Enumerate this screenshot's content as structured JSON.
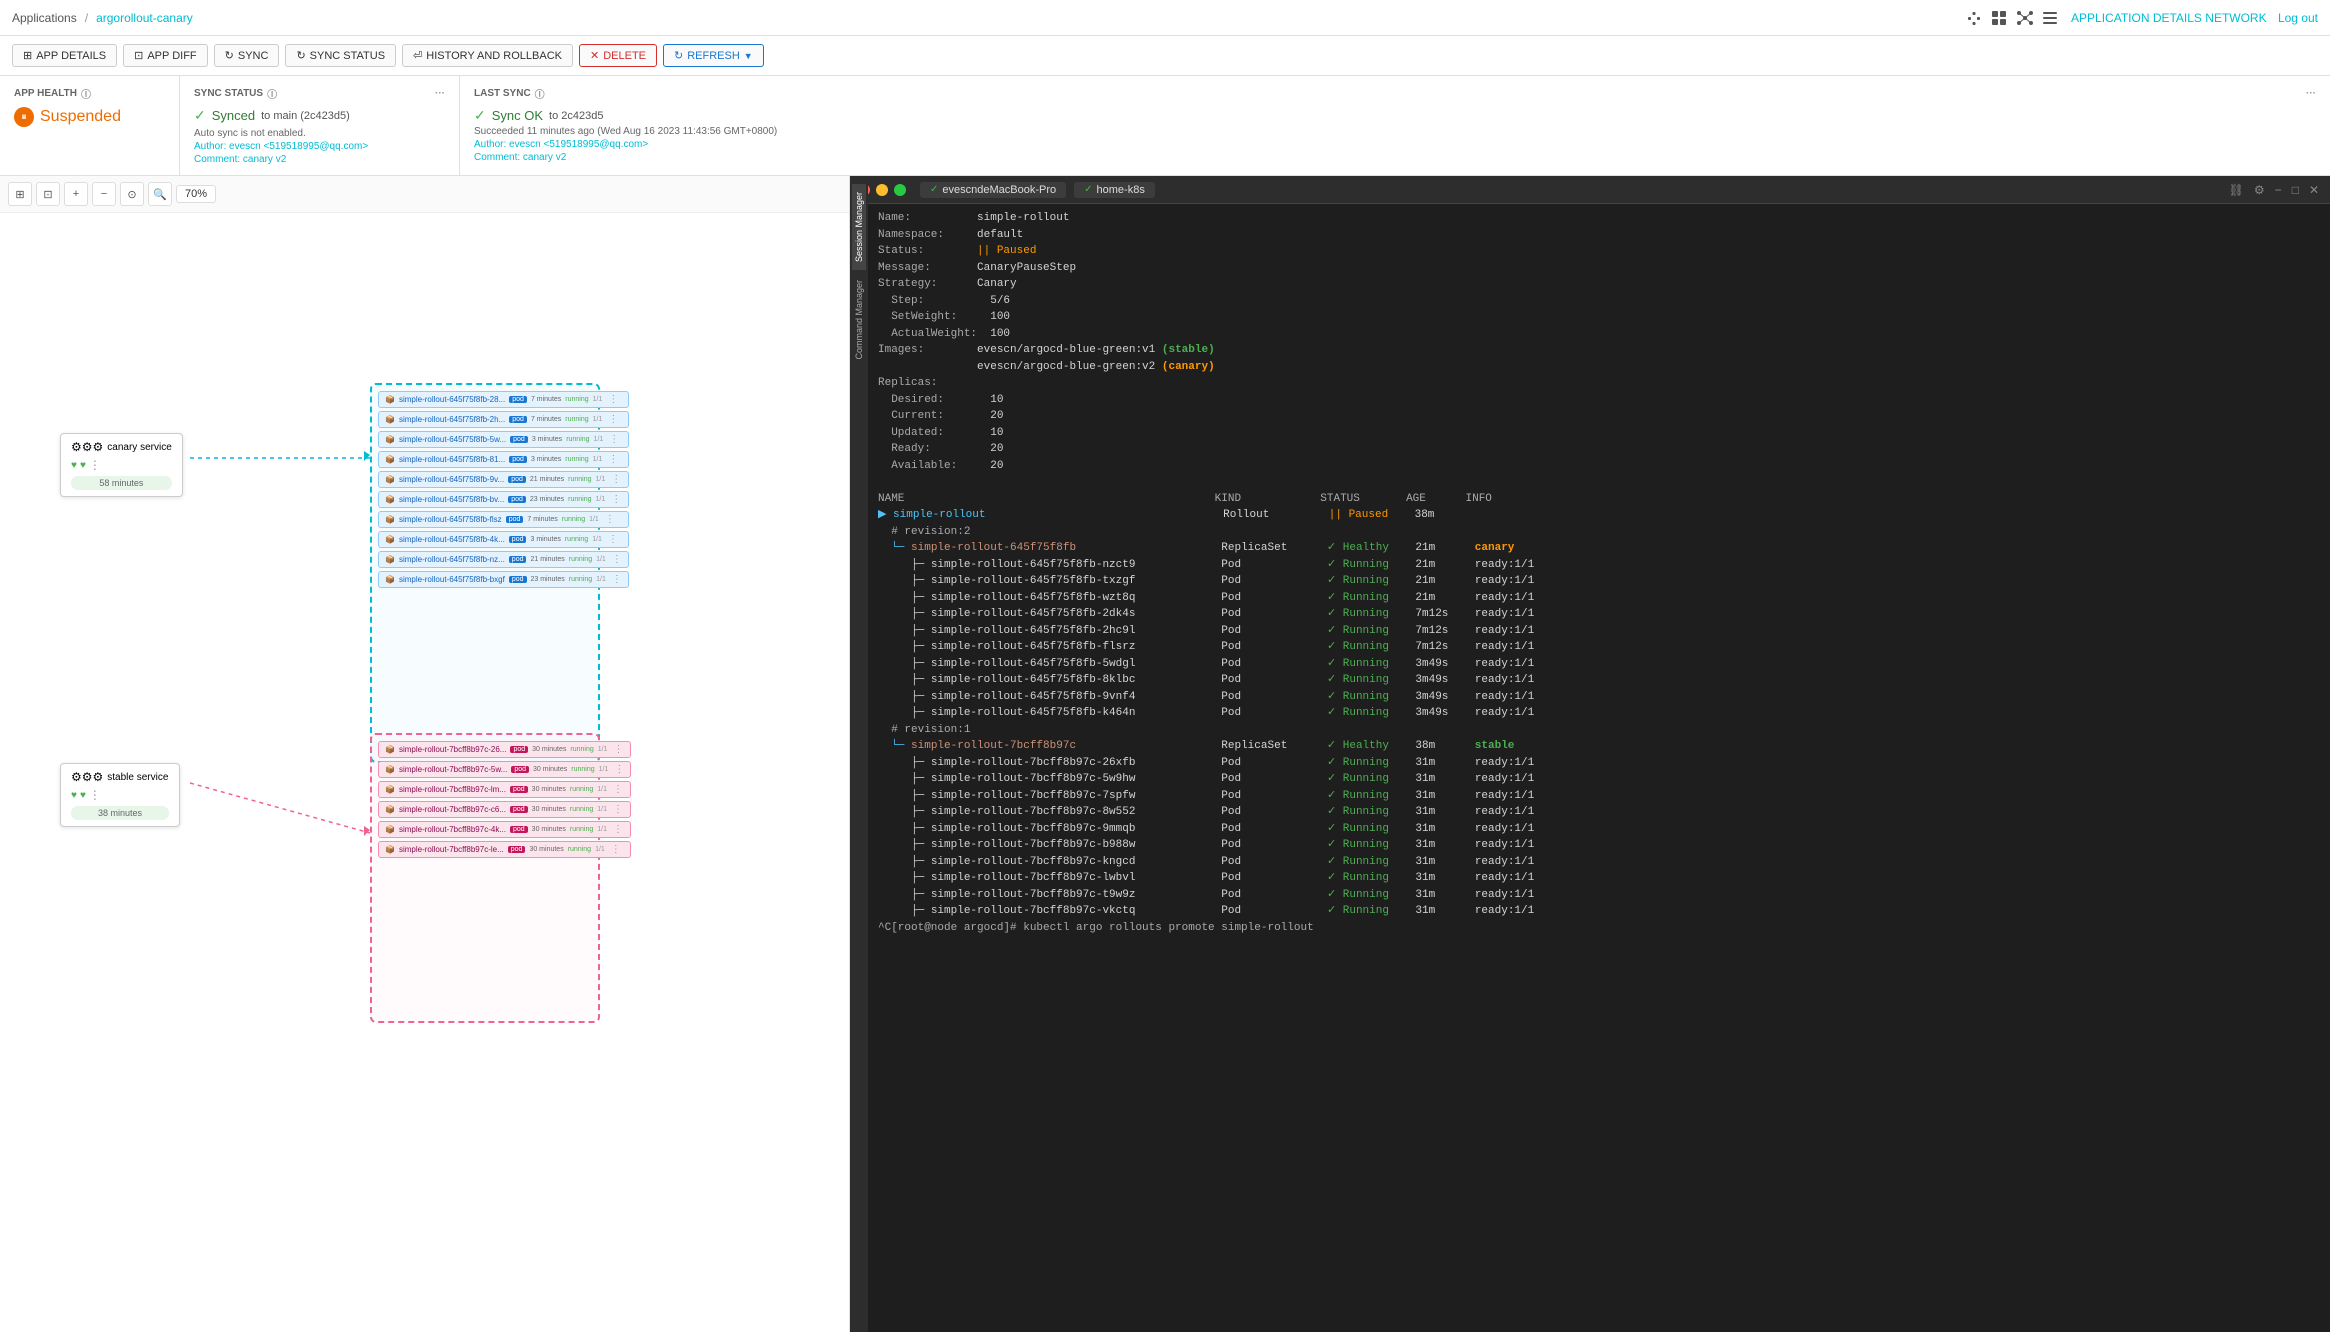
{
  "nav": {
    "applications_label": "Applications",
    "app_name": "argorollout-canary",
    "right_nav": "APPLICATION DETAILS  NETWORK",
    "logout": "Log out"
  },
  "toolbar": {
    "app_details": "APP DETAILS",
    "app_diff": "APP DIFF",
    "sync": "SYNC",
    "sync_status": "SYNC STATUS",
    "history_rollback": "HISTORY AND ROLLBACK",
    "delete": "DELETE",
    "refresh": "REFRESH"
  },
  "status": {
    "app_health_label": "APP HEALTH",
    "health_value": "Suspended",
    "sync_status_label": "SYNC STATUS",
    "synced_text": "Synced",
    "synced_to": "to main (2c423d5)",
    "auto_sync_note": "Auto sync is not enabled.",
    "author_label": "Author:",
    "author_value": "evescn <519518995@qq.com>",
    "comment_label": "Comment:",
    "comment_value": "canary v2",
    "last_sync_label": "LAST SYNC",
    "sync_ok_text": "Sync OK",
    "sync_ok_to": "to 2c423d5",
    "sync_ok_detail": "Succeeded 11 minutes ago (Wed Aug 16 2023 11:43:56 GMT+0800)",
    "sync_ok_author": "evescn <519518995@qq.com>",
    "sync_ok_comment": "canary v2"
  },
  "graph": {
    "zoom": "70%",
    "canary_service_label": "canary service",
    "stable_service_label": "stable service",
    "canary_time": "58 minutes",
    "stable_time": "38 minutes",
    "pods_canary": [
      "simple-rollout-645f75f8fb-28...",
      "simple-rollout-645f75f8fb-2h...",
      "simple-rollout-645f75f8fb-5w...",
      "simple-rollout-645f75f8fb-81...",
      "simple-rollout-645f75f8fb-9v...",
      "simple-rollout-645f75f8fb-bv...",
      "simple-rollout-645f75f8fb-flsz",
      "simple-rollout-645f75f8fb-4k...",
      "simple-rollout-645f75f8fb-nz...",
      "simple-rollout-645f75f8fb-bxgf"
    ],
    "pods_stable": [
      "simple-rollout-7bcff8b97c-26...",
      "simple-rollout-7bcff8b97c-5w...",
      "simple-rollout-7bcff8b97c-lm...",
      "simple-rollout-7bcff8b97c-c6...",
      "simple-rollout-7bcff8b97c-4k...",
      "simple-rollout-7bcff8b97c-le..."
    ]
  },
  "terminal": {
    "tab1": "evescndeMacBook-Pro",
    "tab2": "home-k8s",
    "side_tab1": "Session Manager",
    "side_tab2": "Command Manager",
    "content": {
      "name": "simple-rollout",
      "namespace": "default",
      "status": "|| Paused",
      "message": "CanaryPauseStep",
      "strategy": "Canary",
      "step": "5/6",
      "set_weight": "100",
      "actual_weight": "100",
      "images_label": "Images:",
      "image1": "evescn/argocd-blue-green:v1",
      "image1_tag": "(stable)",
      "image2": "evescn/argocd-blue-green:v2",
      "image2_tag": "(canary)",
      "replicas_label": "Replicas:",
      "desired": "10",
      "current": "20",
      "updated": "10",
      "ready": "20",
      "available": "20",
      "col_name": "NAME",
      "col_kind": "KIND",
      "col_status": "STATUS",
      "col_age": "AGE",
      "col_info": "INFO",
      "rollout_name": "simple-rollout",
      "rollout_kind": "Rollout",
      "rollout_status": "|| Paused",
      "rollout_age": "38m",
      "revision2": "# revision:2",
      "rs_canary": "simple-rollout-645f75f8fb",
      "rs_canary_kind": "ReplicaSet",
      "rs_canary_status": "✓ Healthy",
      "rs_canary_age": "21m",
      "rs_canary_info": "canary",
      "pods_canary": [
        {
          "name": "simple-rollout-645f75f8fb-nzct9",
          "status": "Running",
          "age": "21m",
          "info": "ready:1/1"
        },
        {
          "name": "simple-rollout-645f75f8fb-txzgf",
          "status": "Running",
          "age": "21m",
          "info": "ready:1/1"
        },
        {
          "name": "simple-rollout-645f75f8fb-wzt8q",
          "status": "Running",
          "age": "21m",
          "info": "ready:1/1"
        },
        {
          "name": "simple-rollout-645f75f8fb-2dk4s",
          "status": "Running",
          "age": "7m12s",
          "info": "ready:1/1"
        },
        {
          "name": "simple-rollout-645f75f8fb-2hc9l",
          "status": "Running",
          "age": "7m12s",
          "info": "ready:1/1"
        },
        {
          "name": "simple-rollout-645f75f8fb-flsrz",
          "status": "Running",
          "age": "7m12s",
          "info": "ready:1/1"
        },
        {
          "name": "simple-rollout-645f75f8fb-5wdgl",
          "status": "Running",
          "age": "3m49s",
          "info": "ready:1/1"
        },
        {
          "name": "simple-rollout-645f75f8fb-8klbc",
          "status": "Running",
          "age": "3m49s",
          "info": "ready:1/1"
        },
        {
          "name": "simple-rollout-645f75f8fb-9vnf4",
          "status": "Running",
          "age": "3m49s",
          "info": "ready:1/1"
        },
        {
          "name": "simple-rollout-645f75f8fb-k464n",
          "status": "Running",
          "age": "3m49s",
          "info": "ready:1/1"
        }
      ],
      "revision1": "# revision:1",
      "rs_stable": "simple-rollout-7bcff8b97c",
      "rs_stable_kind": "ReplicaSet",
      "rs_stable_status": "✓ Healthy",
      "rs_stable_age": "38m",
      "rs_stable_info": "stable",
      "pods_stable": [
        {
          "name": "simple-rollout-7bcff8b97c-26xfb",
          "status": "Running",
          "age": "31m",
          "info": "ready:1/1"
        },
        {
          "name": "simple-rollout-7bcff8b97c-5w9hw",
          "status": "Running",
          "age": "31m",
          "info": "ready:1/1"
        },
        {
          "name": "simple-rollout-7bcff8b97c-7spfw",
          "status": "Running",
          "age": "31m",
          "info": "ready:1/1"
        },
        {
          "name": "simple-rollout-7bcff8b97c-8w552",
          "status": "Running",
          "age": "31m",
          "info": "ready:1/1"
        },
        {
          "name": "simple-rollout-7bcff8b97c-9mmqb",
          "status": "Running",
          "age": "31m",
          "info": "ready:1/1"
        },
        {
          "name": "simple-rollout-7bcff8b97c-b988w",
          "status": "Running",
          "age": "31m",
          "info": "ready:1/1"
        },
        {
          "name": "simple-rollout-7bcff8b97c-kngcd",
          "status": "Running",
          "age": "31m",
          "info": "ready:1/1"
        },
        {
          "name": "simple-rollout-7bcff8b97c-lwbvl",
          "status": "Running",
          "age": "31m",
          "info": "ready:1/1"
        },
        {
          "name": "simple-rollout-7bcff8b97c-t9w9z",
          "status": "Running",
          "age": "31m",
          "info": "ready:1/1"
        },
        {
          "name": "simple-rollout-7bcff8b97c-vkctq",
          "status": "Running",
          "age": "31m",
          "info": "ready:1/1"
        }
      ],
      "prompt": "^C[root@node argocd]# kubectl argo rollouts promote simple-rollout"
    }
  }
}
